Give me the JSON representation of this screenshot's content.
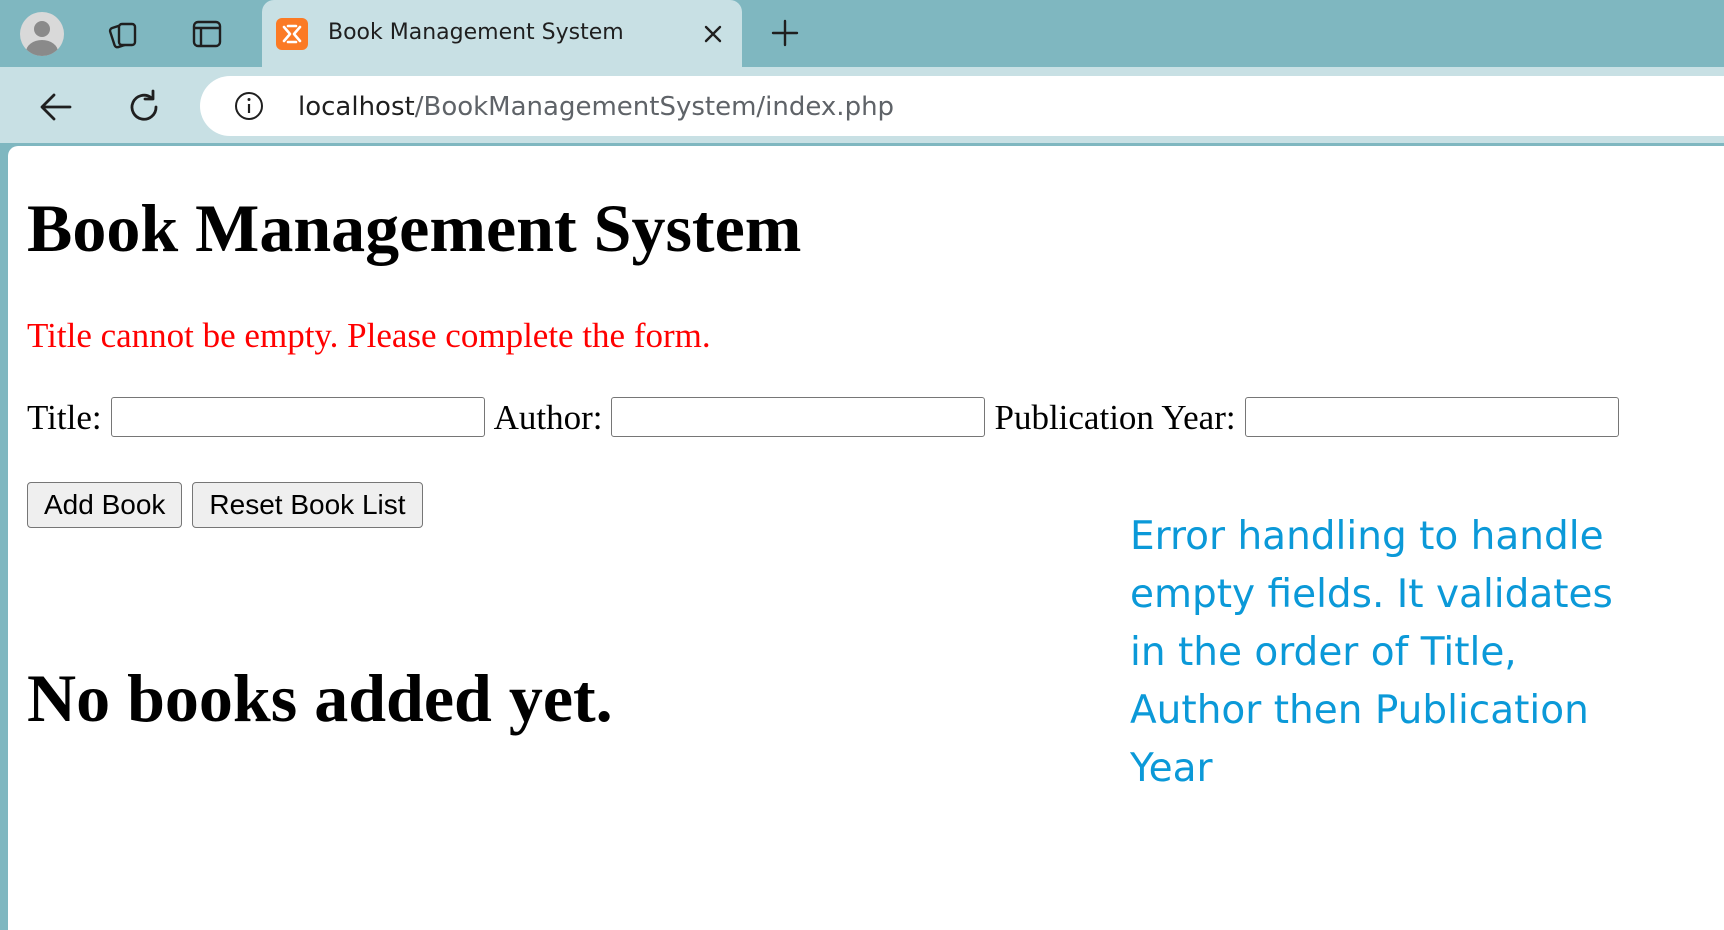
{
  "browser": {
    "tab": {
      "title": "Book Management System",
      "favicon": "xampp-icon",
      "close_icon": "close-icon"
    },
    "toolbar_icons": [
      "profile-avatar",
      "collections-icon",
      "tab-actions-icon",
      "new-tab-icon",
      "back-icon",
      "refresh-icon",
      "site-info-icon"
    ],
    "address_bar": {
      "host": "localhost",
      "path": "/BookManagementSystem/index.php"
    }
  },
  "page": {
    "title": "Book Management System",
    "error_message": "Title cannot be empty. Please complete the form.",
    "error_color": "#ff0000",
    "form": {
      "title_label": "Title:",
      "title_value": "",
      "author_label": "Author:",
      "author_value": "",
      "year_label": "Publication Year:",
      "year_value": ""
    },
    "buttons": {
      "add_label": "Add Book",
      "reset_label": "Reset Book List"
    },
    "empty_state": "No books added yet."
  },
  "annotation": {
    "text": "Error handling to handle empty fields. It validates in the order of Title, Author then Publication Year",
    "color": "#0b99d8"
  },
  "colors": {
    "tab_strip": "#7fb7c0",
    "toolbar": "#c8e0e4",
    "favicon": "#fb7a24"
  }
}
